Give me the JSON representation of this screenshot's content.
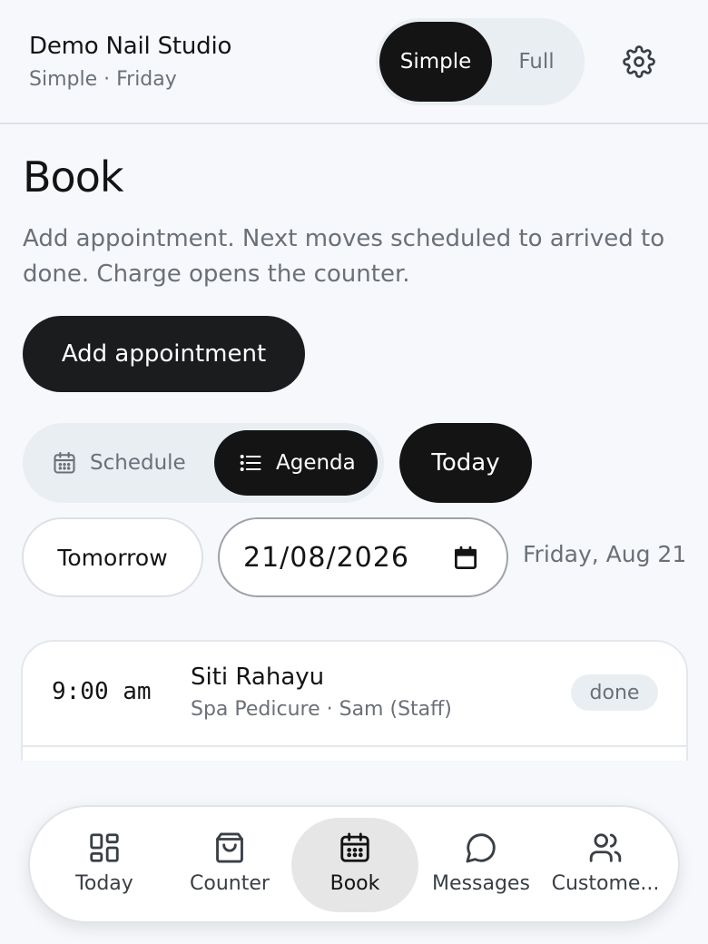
{
  "header": {
    "title": "Demo Nail Studio",
    "subtitle": "Simple · Friday",
    "mode_simple": "Simple",
    "mode_full": "Full",
    "active_mode": "Simple",
    "settings_icon": "gear-icon"
  },
  "main": {
    "title": "Book",
    "description": "Add appointment. Next moves scheduled to arrived to done. Charge opens the counter.",
    "add_button": "Add appointment",
    "view_toggle": {
      "schedule": "Schedule",
      "agenda": "Agenda",
      "active": "Agenda"
    },
    "today_button": "Today",
    "tomorrow_button": "Tomorrow",
    "date_value": "21/08/2026",
    "date_label": "Friday, Aug 21"
  },
  "appointments": [
    {
      "time": "9:00 am",
      "client": "Siti Rahayu",
      "detail": "Spa Pedicure · Sam (Staff)",
      "status": "done"
    }
  ],
  "bottom_nav": {
    "items": [
      {
        "label": "Today",
        "icon": "dashboard-icon"
      },
      {
        "label": "Counter",
        "icon": "shopping-bag-icon"
      },
      {
        "label": "Book",
        "icon": "calendar-icon"
      },
      {
        "label": "Messages",
        "icon": "chat-bubble-icon"
      },
      {
        "label": "Custome...",
        "icon": "users-icon"
      }
    ],
    "active": "Book"
  },
  "colors": {
    "background": "#f6f8fb",
    "primary_dark": "#141414",
    "muted_text": "#6b7078",
    "pill_bg": "#e9eef3"
  }
}
